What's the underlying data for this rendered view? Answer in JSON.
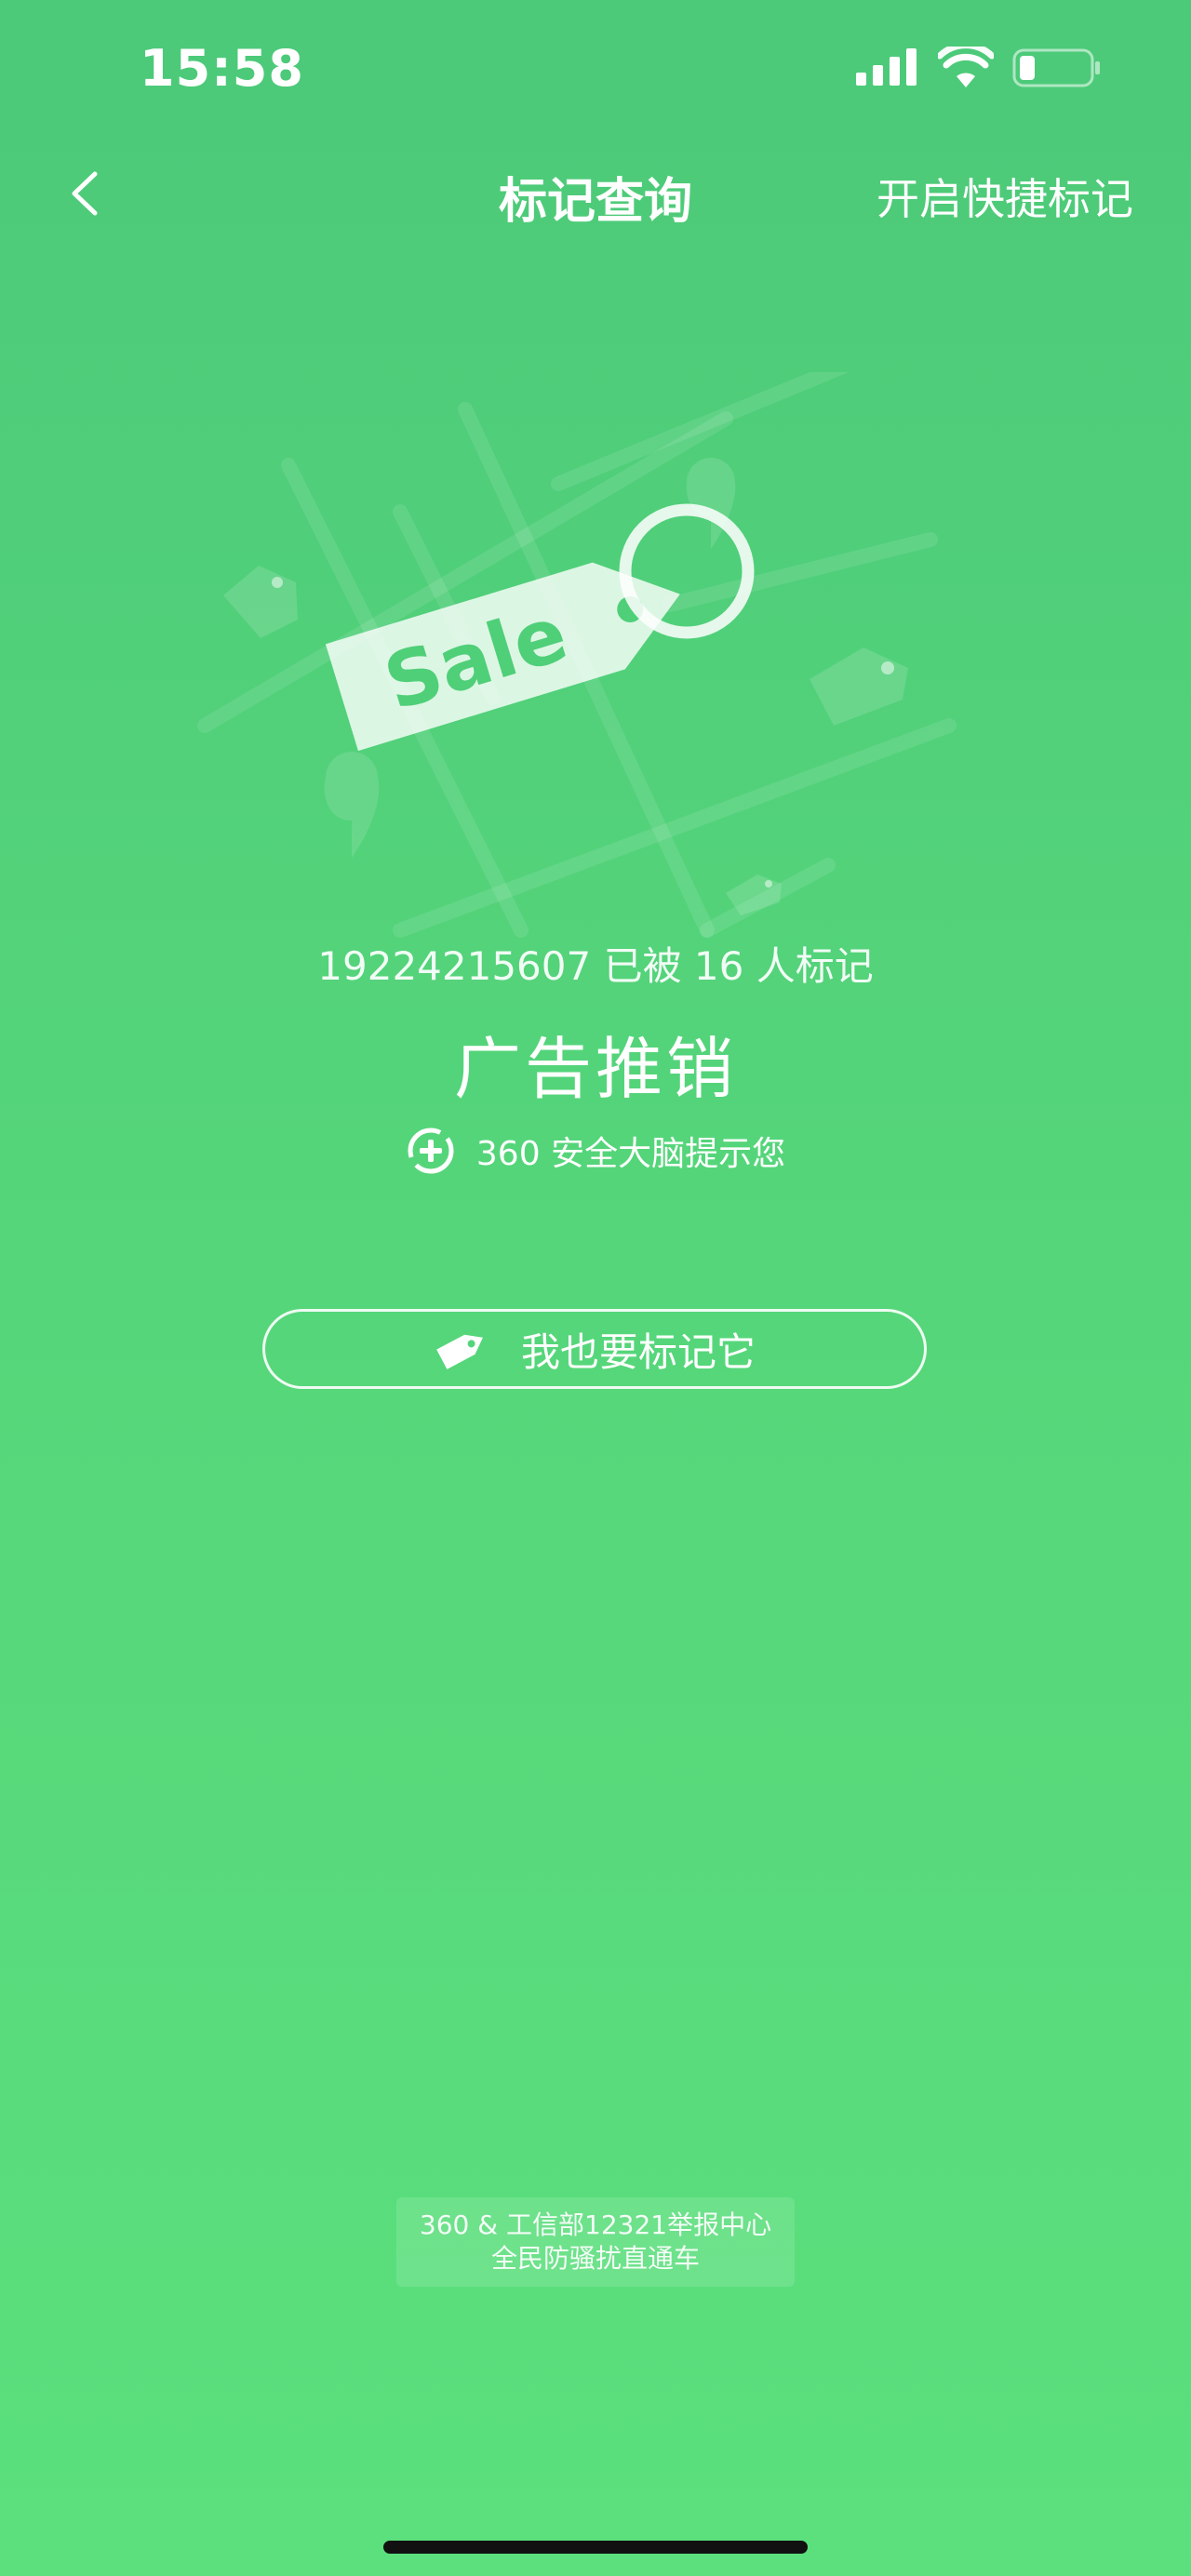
{
  "status_bar": {
    "time": "15:58",
    "icons": [
      "cellular-signal-icon",
      "wifi-icon",
      "battery-icon"
    ]
  },
  "nav": {
    "back_icon": "chevron-left-icon",
    "title": "标记查询",
    "action_label": "开启快捷标记"
  },
  "illustration": {
    "tag_text": "Sale"
  },
  "result": {
    "marked_text": "19224215607 已被 16 人标记",
    "label": "广告推销",
    "source_text": "360 安全大脑提示您",
    "source_icon": "shield-plus-icon"
  },
  "mark_button": {
    "label": "我也要标记它",
    "icon": "tag-icon"
  },
  "footer": {
    "line1": "360 & 工信部12321举报中心",
    "line2": "全民防骚扰直通车"
  },
  "colors": {
    "background_top": "#4cc979",
    "background_bottom": "#5be07d",
    "text": "#ffffff"
  }
}
